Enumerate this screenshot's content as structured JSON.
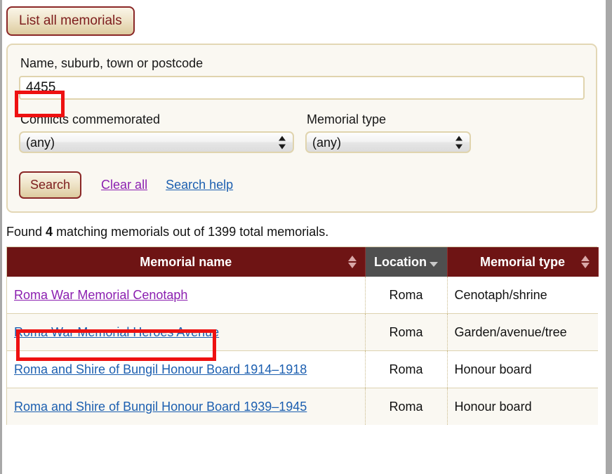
{
  "toolbar": {
    "list_all_label": "List all memorials"
  },
  "search_panel": {
    "query": {
      "label": "Name, suburb, town or postcode",
      "value": "4455",
      "placeholder": ""
    },
    "conflicts": {
      "label": "Conflicts commemorated",
      "value": "(any)"
    },
    "memorial_type": {
      "label": "Memorial type",
      "value": "(any)"
    },
    "search_label": "Search",
    "clear_all_label": "Clear all",
    "search_help_label": "Search help"
  },
  "results": {
    "summary_prefix": "Found ",
    "summary_count": "4",
    "summary_middle": " matching memorials out of ",
    "summary_total": "1399",
    "summary_suffix": " total memorials.",
    "columns": [
      {
        "label": "Memorial name",
        "sort": "both"
      },
      {
        "label": "Location",
        "sort": "desc"
      },
      {
        "label": "Memorial type",
        "sort": "both"
      }
    ],
    "rows": [
      {
        "name": "Roma War Memorial Cenotaph",
        "location": "Roma",
        "type": "Cenotaph/shrine",
        "visited": true
      },
      {
        "name": "Roma War Memorial Heroes Avenue",
        "location": "Roma",
        "type": "Garden/avenue/tree",
        "visited": false
      },
      {
        "name": "Roma and Shire of Bungil Honour Board 1914–1918",
        "location": "Roma",
        "type": "Honour board",
        "visited": false
      },
      {
        "name": "Roma and Shire of Bungil Honour Board 1939–1945",
        "location": "Roma",
        "type": "Honour board",
        "visited": false
      }
    ]
  },
  "colors": {
    "header_maroon": "#6e1414",
    "header_sorted_grey": "#4f4f4f",
    "panel_cream": "#faf8f2",
    "panel_border_tan": "#e3d7b5",
    "link_blue": "#1c5fb0",
    "link_visited_purple": "#8b1fb0",
    "annotation_red": "#ee1111"
  }
}
